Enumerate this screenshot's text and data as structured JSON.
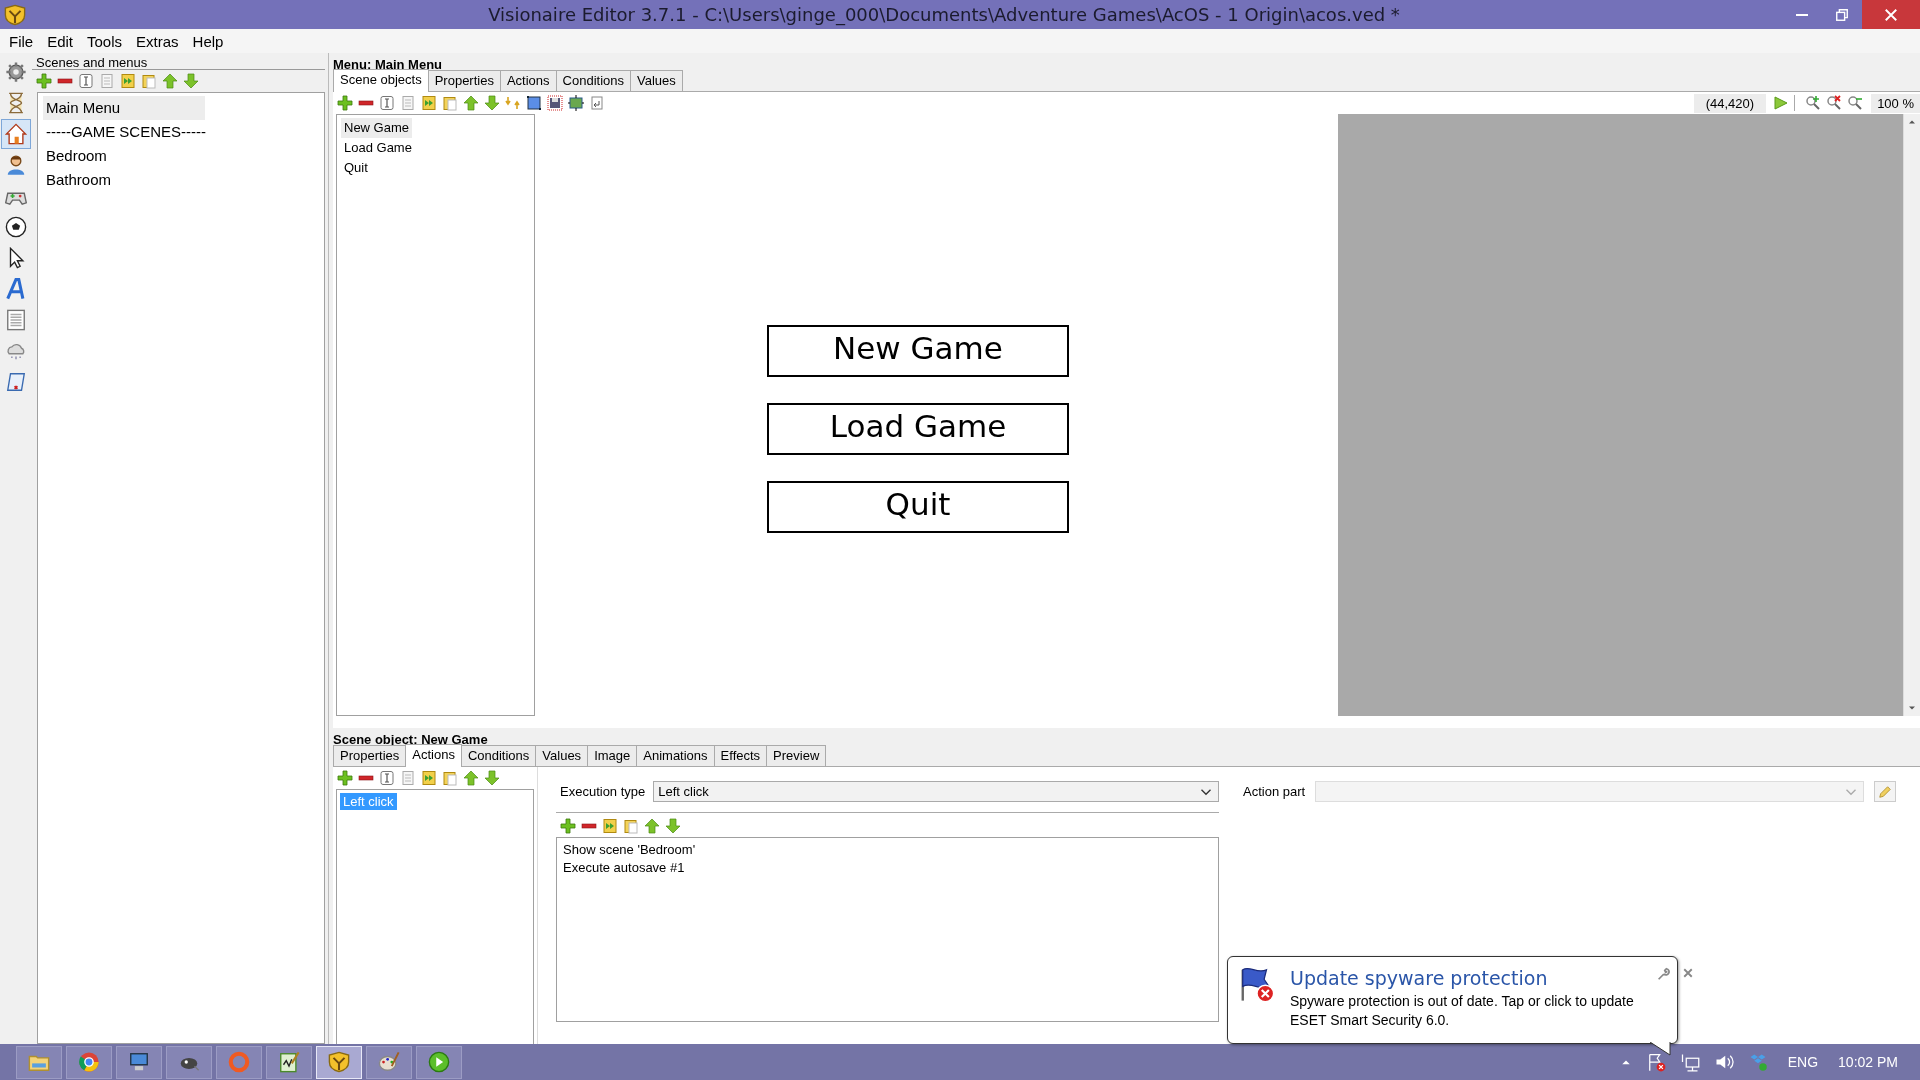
{
  "window": {
    "title": "Visionaire Editor 3.7.1 - C:\\Users\\ginge_000\\Documents\\Adventure Games\\AcOS - 1 Origin\\acos.ved *"
  },
  "menu_bar": [
    {
      "label": "File"
    },
    {
      "label": "Edit"
    },
    {
      "label": "Tools"
    },
    {
      "label": "Extras"
    },
    {
      "label": "Help"
    }
  ],
  "tool_strip": [
    {
      "selected": false
    },
    {
      "selected": false
    },
    {
      "selected": true
    },
    {
      "selected": false
    },
    {
      "selected": false
    },
    {
      "selected": false
    },
    {
      "selected": false
    },
    {
      "selected": false
    },
    {
      "selected": false
    },
    {
      "selected": false
    },
    {
      "selected": false
    }
  ],
  "scenes_panel": {
    "title": "Scenes and menus",
    "items": [
      {
        "label": "Main Menu",
        "selected": true
      },
      {
        "label": "-----GAME SCENES-----",
        "selected": false
      },
      {
        "label": "Bedroom",
        "selected": false
      },
      {
        "label": "Bathroom",
        "selected": false
      }
    ]
  },
  "menu_editor": {
    "title": "Menu: Main Menu",
    "tabs": [
      {
        "label": "Scene objects",
        "selected": true
      },
      {
        "label": "Properties",
        "selected": false
      },
      {
        "label": "Actions",
        "selected": false
      },
      {
        "label": "Conditions",
        "selected": false
      },
      {
        "label": "Values",
        "selected": false
      }
    ],
    "objects": [
      {
        "label": "New Game",
        "selected": true
      },
      {
        "label": "Load Game",
        "selected": false
      },
      {
        "label": "Quit",
        "selected": false
      }
    ],
    "coordinates": "(44,420)",
    "zoom": "100 %",
    "canvas_buttons": [
      "New Game",
      "Load Game",
      "Quit"
    ]
  },
  "object_editor": {
    "title": "Scene object: New Game",
    "tabs": [
      {
        "label": "Properties",
        "selected": false
      },
      {
        "label": "Actions",
        "selected": true
      },
      {
        "label": "Conditions",
        "selected": false
      },
      {
        "label": "Values",
        "selected": false
      },
      {
        "label": "Image",
        "selected": false
      },
      {
        "label": "Animations",
        "selected": false
      },
      {
        "label": "Effects",
        "selected": false
      },
      {
        "label": "Preview",
        "selected": false
      }
    ],
    "actions": [
      {
        "label": "Left click",
        "selected": true
      }
    ],
    "execution_type_label": "Execution type",
    "execution_type": "Left click",
    "action_part_label": "Action part",
    "action_parts": [
      "Show scene 'Bedroom'",
      "Execute autosave #1"
    ]
  },
  "notification": {
    "title": "Update spyware protection",
    "message": "Spyware protection is out of date. Tap or click to update ESET Smart Security 6.0."
  },
  "taskbar": {
    "apps": [
      {
        "selected": false
      },
      {
        "selected": false
      },
      {
        "selected": false
      },
      {
        "selected": false
      },
      {
        "selected": false
      },
      {
        "selected": false
      },
      {
        "selected": true
      },
      {
        "selected": false
      },
      {
        "selected": false
      }
    ],
    "language": "ENG",
    "time": "10:02 PM"
  }
}
